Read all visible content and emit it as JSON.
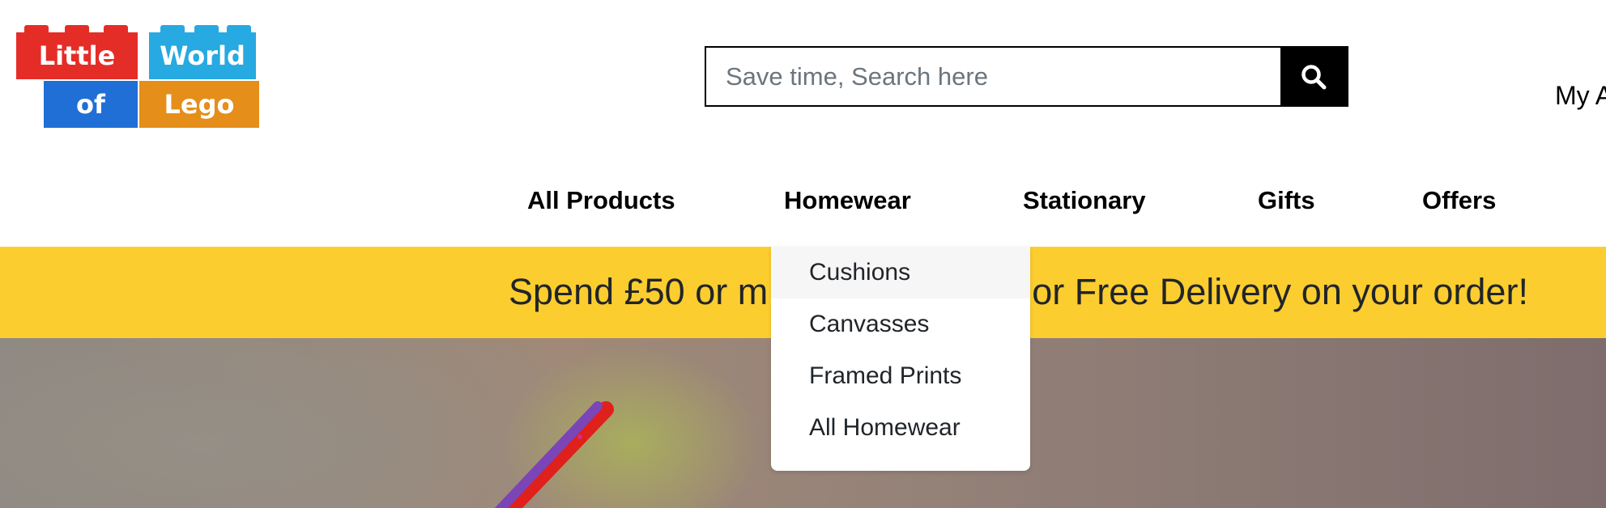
{
  "logo": {
    "words": [
      "Little",
      "World",
      "of",
      "Lego"
    ],
    "colors": [
      "#e52d27",
      "#27a9e1",
      "#1f6fd6",
      "#e58e1a"
    ]
  },
  "search": {
    "placeholder": "Save time, Search here",
    "value": "",
    "icon": "search-icon"
  },
  "account": {
    "label": "My A"
  },
  "nav": {
    "items": [
      {
        "label": "All Products"
      },
      {
        "label": "Homewear"
      },
      {
        "label": "Stationary"
      },
      {
        "label": "Gifts"
      },
      {
        "label": "Offers"
      }
    ]
  },
  "banner": {
    "text_left": "Spend £50 or m",
    "text_right": "or Free Delivery on your order!",
    "background": "#fccd2f"
  },
  "homewear_menu": {
    "items": [
      {
        "label": "Cushions",
        "highlighted": true
      },
      {
        "label": "Canvasses"
      },
      {
        "label": "Framed Prints"
      },
      {
        "label": "All Homewear"
      }
    ]
  }
}
